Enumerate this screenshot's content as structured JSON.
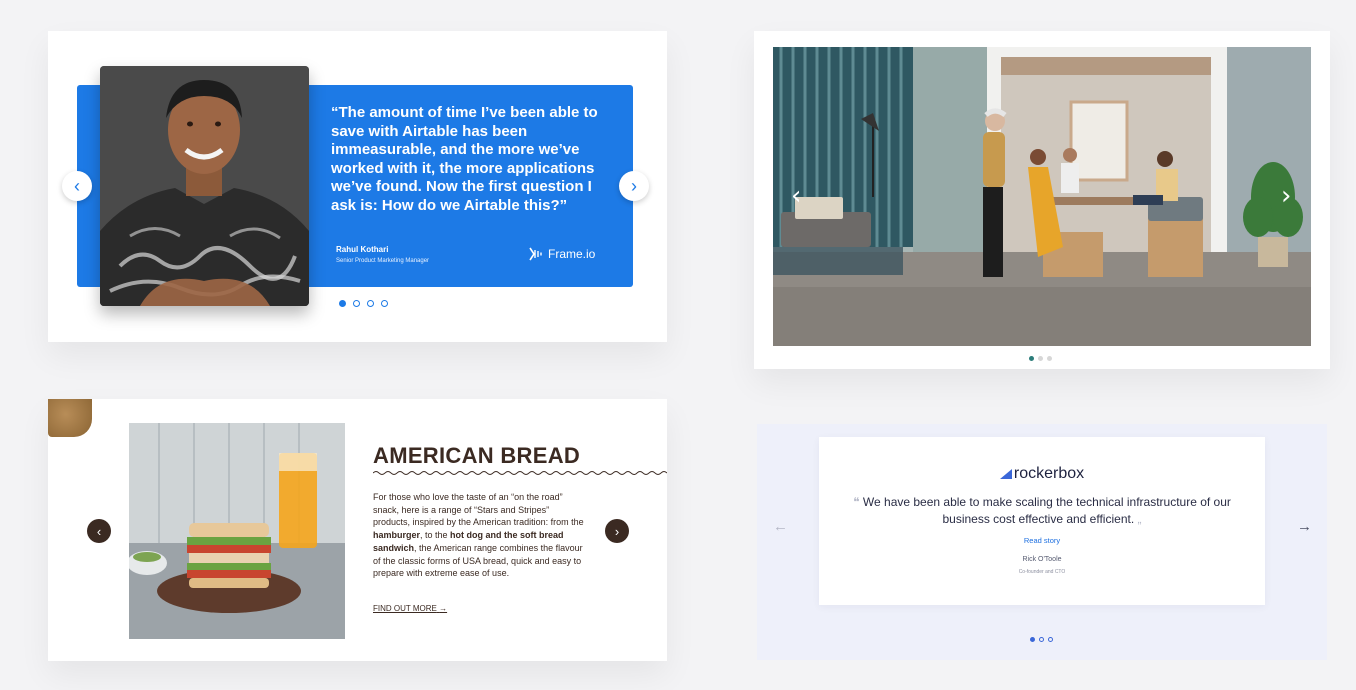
{
  "airtable_card": {
    "quote": "“The amount of time I’ve been able to save with Airtable has been immeasurable, and the more we’ve worked with it, the more applications we’ve found. Now the first question I ask is: How do we Airtable this?”",
    "author_name": "Rahul Kothari",
    "author_role": "Senior Product Marketing Manager",
    "company_logo": "Frame.io",
    "prev_icon": "chevron-left-icon",
    "next_icon": "chevron-right-icon",
    "pagination": {
      "total": 4,
      "active": 1
    },
    "accent_color": "#1d7ae6"
  },
  "office_slider": {
    "prev_icon": "chevron-left-icon",
    "next_icon": "chevron-right-icon",
    "pagination": {
      "total": 3,
      "active": 1
    },
    "accent_color": "#2b7d7a"
  },
  "bread_card": {
    "title": "AMERICAN BREAD",
    "body_1": "For those who love the taste of an “on the road” snack, here is a range of “Stars and Stripes” products, inspired by the American tradition: from the ",
    "bold_1": "hamburger",
    "body_2": ", to the ",
    "bold_2": "hot dog and the soft bread sandwich",
    "body_3": ", the American range combines the flavour of the classic forms of USA bread, quick and easy to prepare with extreme ease of use.",
    "cta": "FIND OUT MORE",
    "cta_arrow": "→",
    "prev_icon": "chevron-left-icon",
    "next_icon": "chevron-right-icon",
    "accent_color": "#3b2a22"
  },
  "rockerbox_card": {
    "brand": "rockerbox",
    "quote": "We have been able to make scaling the technical infrastructure of our business cost effective and efficient.",
    "open_quote": "❝",
    "close_quote": "„",
    "read_story": "Read story",
    "author_name": "Rick O'Toole",
    "author_role": "Co-founder and CTO",
    "prev_arrow": "←",
    "next_arrow": "→",
    "pagination": {
      "total": 3,
      "active": 1
    },
    "accent_color": "#1d6fe0"
  }
}
